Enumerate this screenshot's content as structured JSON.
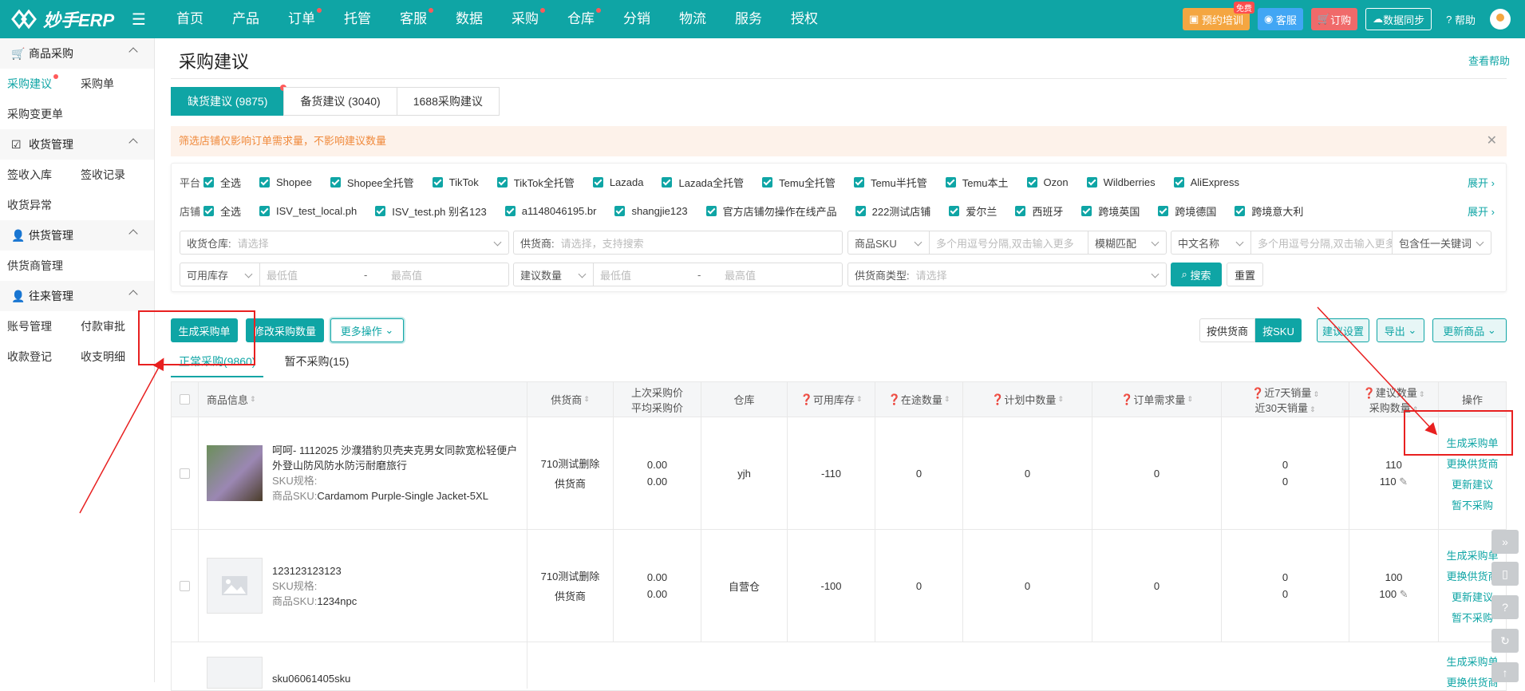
{
  "app": {
    "logo_text": "妙手ERP"
  },
  "nav": [
    "首页",
    "产品",
    "订单",
    "托管",
    "客服",
    "数据",
    "采购",
    "仓库",
    "分销",
    "物流",
    "服务",
    "授权"
  ],
  "top_actions": {
    "training": "预约培训",
    "free_badge": "免费",
    "service": "客服",
    "order": "订购",
    "sync": "数据同步",
    "help": "帮助"
  },
  "sidebar": {
    "groups": [
      {
        "title": "商品采购",
        "items": [
          "采购建议",
          "采购单",
          "采购变更单"
        ]
      },
      {
        "title": "收货管理",
        "items": [
          "签收入库",
          "签收记录",
          "收货异常"
        ]
      },
      {
        "title": "供货管理",
        "items": [
          "供货商管理"
        ]
      },
      {
        "title": "往来管理",
        "items": [
          "账号管理",
          "付款审批",
          "收款登记",
          "收支明细"
        ]
      }
    ]
  },
  "page": {
    "title": "采购建议",
    "help_link": "查看帮助"
  },
  "tabs": [
    "缺货建议 (9875)",
    "备货建议 (3040)",
    "1688采购建议"
  ],
  "notice": "筛选店铺仅影响订单需求量，不影响建议数量",
  "filters": {
    "platform_label": "平台",
    "platforms": [
      "全选",
      "Shopee",
      "Shopee全托管",
      "TikTok",
      "TikTok全托管",
      "Lazada",
      "Lazada全托管",
      "Temu全托管",
      "Temu半托管",
      "Temu本土",
      "Ozon",
      "Wildberries",
      "AliExpress"
    ],
    "store_label": "店铺",
    "stores": [
      "全选",
      "ISV_test_local.ph",
      "ISV_test.ph 别名123",
      "a1148046195.br",
      "shangjie123",
      "官方店铺勿操作在线产品",
      "222测试店铺",
      "爱尔兰",
      "西班牙",
      "跨境英国",
      "跨境德国",
      "跨境意大利"
    ],
    "expand": "展开",
    "warehouse_label": "收货仓库:",
    "warehouse_ph": "请选择",
    "supplier_label": "供货商:",
    "supplier_ph": "请选择，支持搜索",
    "sku_select": "商品SKU",
    "sku_ph": "多个用逗号分隔,双击输入更多",
    "match_select": "模糊匹配",
    "name_select": "中文名称",
    "name_ph": "多个用逗号分隔,双击输入更多",
    "keyword_select": "包含任一关键词",
    "stock_select": "可用库存",
    "min_ph": "最低值",
    "max_ph": "最高值",
    "dash": "-",
    "suggest_select": "建议数量",
    "supplier_type_label": "供货商类型:",
    "supplier_type_ph": "请选择",
    "search": "搜索",
    "reset": "重置"
  },
  "toolbar": {
    "generate": "生成采购单",
    "modify": "修改采购数量",
    "more": "更多操作",
    "by_supplier": "按供货商",
    "by_sku": "按SKU",
    "settings": "建议设置",
    "export": "导出",
    "update": "更新商品"
  },
  "subtabs": [
    "正常采购(9860)",
    "暂不采购(15)"
  ],
  "table": {
    "headers": [
      "商品信息",
      "供货商",
      "上次采购价",
      "平均采购价",
      "仓库",
      "可用库存",
      "在途数量",
      "计划中数量",
      "订单需求量",
      "近7天销量",
      "近30天销量",
      "建议数量",
      "采购数量",
      "操作"
    ],
    "rows": [
      {
        "title": "呵呵- 1112025 沙濮猎豹贝壳夹克男女同款宽松轻便户外登山防风防水防污耐磨旅行",
        "spec_label": "SKU规格:",
        "sku_label": "商品SKU:",
        "sku": "Cardamom Purple-Single Jacket-5XL",
        "supplier1": "710测试删除",
        "supplier2": "供货商",
        "last_price": "0.00",
        "avg_price": "0.00",
        "warehouse": "yjh",
        "stock": "-110",
        "transit": "0",
        "planned": "0",
        "demand": "0",
        "sales7": "0",
        "sales30": "0",
        "suggest": "110",
        "qty": "110",
        "ops": [
          "生成采购单",
          "更换供货商",
          "更新建议",
          "暂不采购"
        ]
      },
      {
        "title": "123123123123",
        "spec_label": "SKU规格:",
        "sku_label": "商品SKU:",
        "sku": "1234npc",
        "supplier1": "710测试删除",
        "supplier2": "供货商",
        "last_price": "0.00",
        "avg_price": "0.00",
        "warehouse": "自营仓",
        "stock": "-100",
        "transit": "0",
        "planned": "0",
        "demand": "0",
        "sales7": "0",
        "sales30": "0",
        "suggest": "100",
        "qty": "100",
        "ops": [
          "生成采购单",
          "更换供货商",
          "更新建议",
          "暂不采购"
        ]
      },
      {
        "title": "sku06061405sku",
        "ops": [
          "生成采购单",
          "更换供货商"
        ]
      }
    ]
  },
  "colors": {
    "brand": "#0fa5a5",
    "annotation": "#e82020"
  }
}
